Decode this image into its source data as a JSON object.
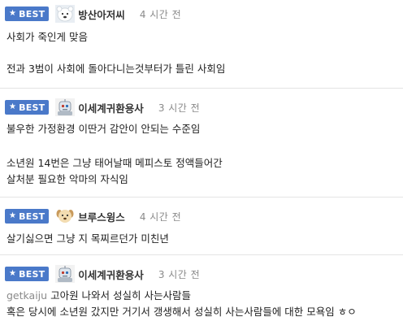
{
  "badge_label": "BEST",
  "comments": [
    {
      "nickname": "방산아저씨",
      "time": "4 시간 전",
      "avatar_icon": "polar-bear-avatar-icon",
      "lines": [
        "사회가 죽인게 맞음",
        "전과 3범이 사회에 돌아다니는것부터가 틀린 사회임"
      ]
    },
    {
      "nickname": "이세계귀환용사",
      "time": "3 시간 전",
      "avatar_icon": "robot-avatar-icon",
      "lines": [
        "불우한 가정환경 이딴거 감안이 안되는 수준임",
        "소년원 14번은 그냥 태어날때 메피스토 정액들어간",
        "살처분 필요한 악마의 자식임"
      ]
    },
    {
      "nickname": "브루스윙스",
      "time": "4 시간 전",
      "avatar_icon": "puppy-avatar-icon",
      "lines": [
        "살기싫으면 그냥 지 목찌르던가 미친년"
      ]
    },
    {
      "nickname": "이세계귀환용사",
      "time": "3 시간 전",
      "avatar_icon": "robot-avatar-icon",
      "mention": "getkaiju",
      "lines": [
        "고아원 나와서 성실히 사는사람들",
        "혹은 당시에 소년원 갔지만 거기서 갱생해서 성실히 사는사람들에 대한 모욕임 ㅎㅇ"
      ]
    }
  ],
  "colors": {
    "badge_bg": "#4a79c9",
    "divider": "#e4e4e4",
    "time_text": "#8a8a8a",
    "mention_text": "#8a8a8a"
  }
}
